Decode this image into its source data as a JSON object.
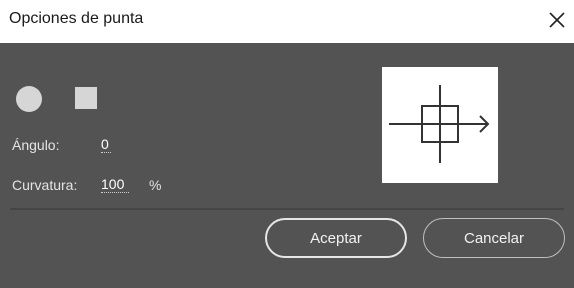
{
  "dialog": {
    "title": "Opciones de punta",
    "close_icon": "close-icon"
  },
  "tip_shapes": [
    {
      "name": "round",
      "icon": "circle-icon"
    },
    {
      "name": "square",
      "icon": "square-icon"
    }
  ],
  "fields": {
    "angle_label": "Ángulo:",
    "angle_value": "0",
    "curvature_label": "Curvatura:",
    "curvature_value": "100",
    "curvature_unit": "%"
  },
  "preview": {
    "icon": "brush-tip-preview"
  },
  "buttons": {
    "ok_label": "Aceptar",
    "cancel_label": "Cancelar"
  },
  "colors": {
    "panel_bg": "#535353",
    "titlebar_bg": "#ffffff",
    "text": "#e4e4e4",
    "shape_fill": "#d6d6d6"
  }
}
